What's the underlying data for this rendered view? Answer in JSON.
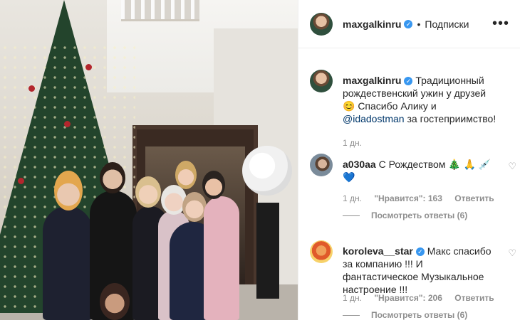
{
  "header": {
    "username": "maxgalkinru",
    "follow_label": "Подписки",
    "more_icon": "more-horizontal-icon"
  },
  "caption": {
    "username": "maxgalkinru",
    "text_1": "Традиционный рождественский ужин у друзей 😊 Спасибо Алику и",
    "mention": "@idadostman",
    "text_2": "за гостеприимство!",
    "time": "1 дн."
  },
  "comments": [
    {
      "username": "a030aa",
      "text": "С Рождеством 🎄 🙏 💉💙",
      "time": "1 дн.",
      "likes": "\"Нравится\": 163",
      "reply": "Ответить",
      "view_replies": "Посмотреть ответы (6)"
    },
    {
      "username": "koroleva__star",
      "text": "Макс спасибо за компанию !!! И фантастическое Музыкальное настроение !!!",
      "time": "1 дн.",
      "likes": "\"Нравится\": 206",
      "reply": "Ответить",
      "view_replies": "Посмотреть ответы (6)"
    }
  ],
  "colors": {
    "verified": "#3897f0",
    "meta": "#8e8e8e",
    "mention": "#00376b"
  }
}
